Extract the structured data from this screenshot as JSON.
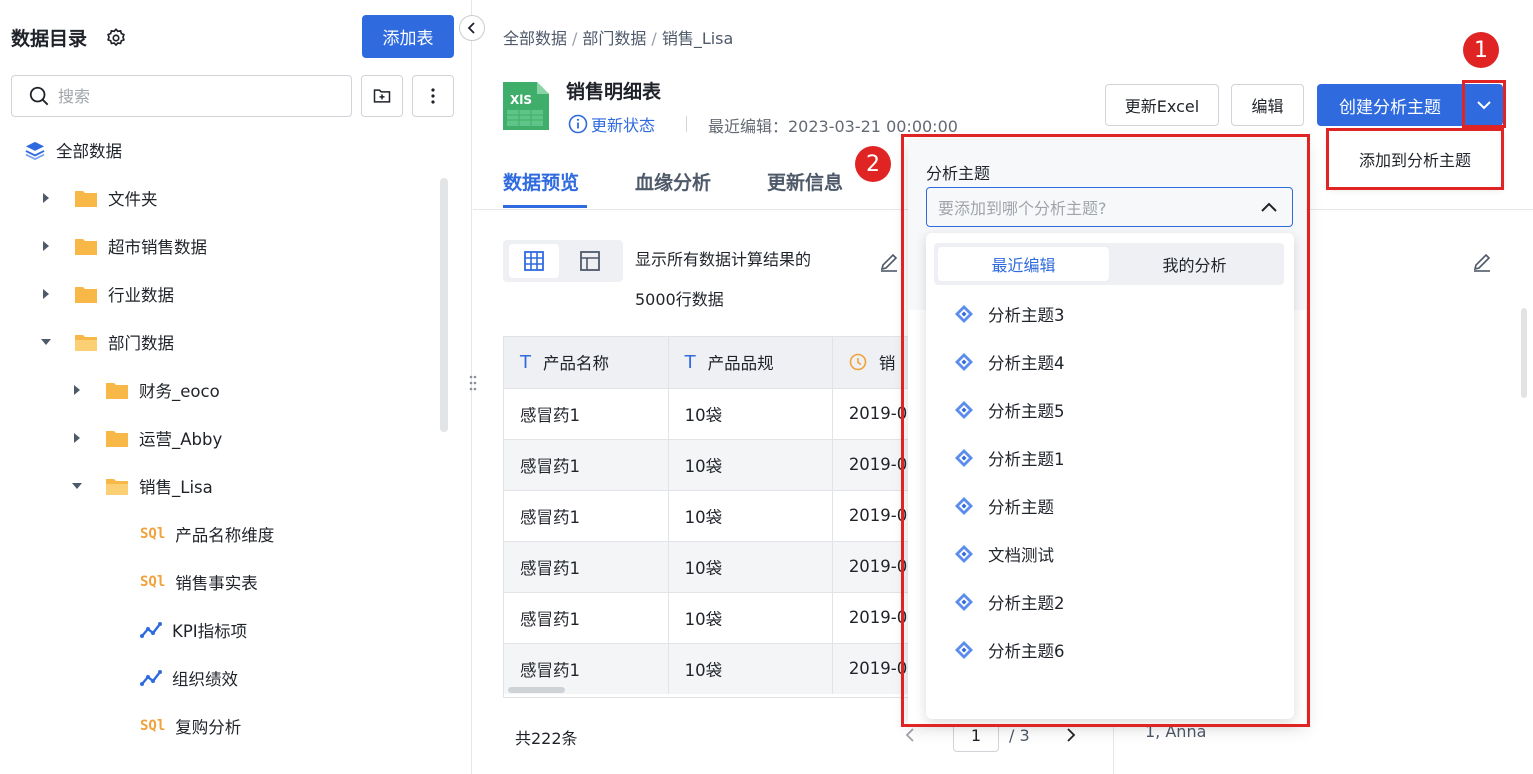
{
  "sidebar": {
    "title": "数据目录",
    "add_table_label": "添加表",
    "search_placeholder": "搜索",
    "root_label": "全部数据",
    "items": [
      {
        "label": "文件夹",
        "type": "folder",
        "expanded": false
      },
      {
        "label": "超市销售数据",
        "type": "folder",
        "expanded": false
      },
      {
        "label": "行业数据",
        "type": "folder",
        "expanded": false
      },
      {
        "label": "部门数据",
        "type": "folder",
        "expanded": true
      },
      {
        "label": "财务_eoco",
        "type": "folder",
        "expanded": false
      },
      {
        "label": "运营_Abby",
        "type": "folder",
        "expanded": false
      },
      {
        "label": "销售_Lisa",
        "type": "folder",
        "expanded": true
      },
      {
        "label": "产品名称维度",
        "type": "sql"
      },
      {
        "label": "销售事实表",
        "type": "sql"
      },
      {
        "label": "KPI指标项",
        "type": "metric"
      },
      {
        "label": "组织绩效",
        "type": "metric"
      },
      {
        "label": "复购分析",
        "type": "sql"
      }
    ]
  },
  "breadcrumb": [
    "全部数据",
    "部门数据",
    "销售_Lisa"
  ],
  "header": {
    "title": "销售明细表",
    "status_link": "更新状态",
    "last_edit": "最近编辑：2023-03-21 00:00:00",
    "update_excel_label": "更新Excel",
    "edit_label": "编辑",
    "create_topic_label": "创建分析主题"
  },
  "tabs": [
    {
      "label": "数据预览",
      "active": true
    },
    {
      "label": "血缘分析",
      "active": false
    },
    {
      "label": "更新信息",
      "active": false
    }
  ],
  "preview": {
    "info_line1": "显示所有数据计算结果的",
    "info_line2": "5000行数据",
    "columns": [
      "产品名称",
      "产品品规",
      "销"
    ],
    "rows": [
      [
        "感冒药1",
        "10袋",
        "2019-0"
      ],
      [
        "感冒药1",
        "10袋",
        "2019-0"
      ],
      [
        "感冒药1",
        "10袋",
        "2019-0"
      ],
      [
        "感冒药1",
        "10袋",
        "2019-0"
      ],
      [
        "感冒药1",
        "10袋",
        "2019-0"
      ],
      [
        "感冒药1",
        "10袋",
        "2019-0"
      ]
    ],
    "total": "共222条",
    "page_current": "1",
    "page_total": "/ 3",
    "right_panel_text": "1, Anna"
  },
  "dropdown_menu": {
    "add_to_topic": "添加到分析主题"
  },
  "topic_panel": {
    "label": "分析主题",
    "placeholder": "要添加到哪个分析主题?",
    "tab_recent": "最近编辑",
    "tab_mine": "我的分析",
    "topics": [
      "分析主题3",
      "分析主题4",
      "分析主题5",
      "分析主题1",
      "分析主题",
      "文档测试",
      "分析主题2",
      "分析主题6"
    ]
  },
  "annotations": {
    "badge1": "1",
    "badge2": "2"
  },
  "colors": {
    "accent": "#2f6bde",
    "highlight": "#e02424",
    "folder": "#f7b847",
    "sql": "#f0a23b"
  }
}
